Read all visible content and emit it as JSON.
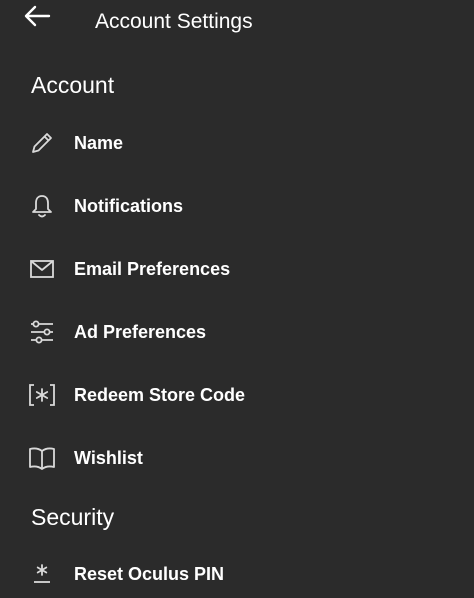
{
  "header": {
    "back_icon": "arrow-left-icon",
    "title": "Account Settings"
  },
  "sections": [
    {
      "heading": "Account",
      "items": [
        {
          "label": "Name",
          "icon": "pencil-icon"
        },
        {
          "label": "Notifications",
          "icon": "bell-icon"
        },
        {
          "label": "Email Preferences",
          "icon": "envelope-icon"
        },
        {
          "label": "Ad Preferences",
          "icon": "sliders-icon"
        },
        {
          "label": "Redeem Store Code",
          "icon": "bracket-asterisk-icon"
        },
        {
          "label": "Wishlist",
          "icon": "book-icon"
        }
      ]
    },
    {
      "heading": "Security",
      "items": [
        {
          "label": "Reset Oculus PIN",
          "icon": "asterisk-icon"
        }
      ]
    }
  ],
  "colors": {
    "background": "#2b2b2b",
    "text": "#ffffff",
    "icon": "#d9d9d9"
  }
}
